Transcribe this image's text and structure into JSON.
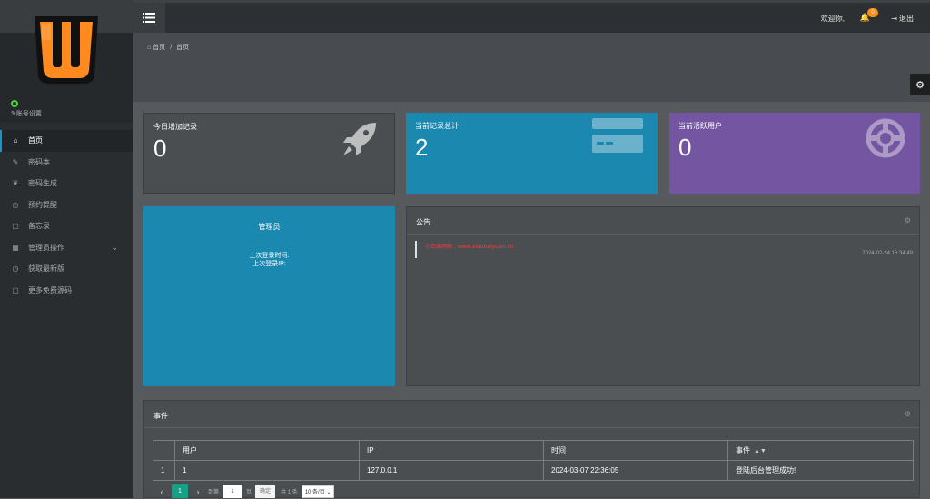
{
  "sidebar": {
    "account_settings": "账号设置",
    "items": [
      {
        "label": "首页",
        "icon": "home-icon",
        "active": true
      },
      {
        "label": "密码本",
        "icon": "edit-icon"
      },
      {
        "label": "密码生成",
        "icon": "leaf-icon"
      },
      {
        "label": "预约提醒",
        "icon": "clock-icon"
      },
      {
        "label": "备忘录",
        "icon": "note-icon"
      },
      {
        "label": "管理员操作",
        "icon": "grid-icon",
        "expandable": true
      },
      {
        "label": "获取最新版",
        "icon": "clock-icon"
      },
      {
        "label": "更多免费源码",
        "icon": "note-icon"
      }
    ]
  },
  "topbar": {
    "welcome": "欢迎你,",
    "bell_count": "0",
    "logout": "退出"
  },
  "breadcrumb": {
    "home": "首页",
    "current": "首页"
  },
  "stats": {
    "today_label": "今日增加记录",
    "today_value": "0",
    "total_label": "当前记录总计",
    "total_value": "2",
    "active_label": "当前活跃用户",
    "active_value": "0"
  },
  "admin": {
    "title": "管理员",
    "last_login_time": "上次登录时间:",
    "last_login_ip": "上次登录IP:"
  },
  "notice": {
    "title": "公告",
    "item_text": "小白源码网 : www.xiaobaiyuan.cn",
    "item_date": "2024-02-24 16:34:49"
  },
  "events": {
    "title": "事件",
    "columns": [
      "",
      "用户",
      "IP",
      "时间",
      "事件"
    ],
    "rows": [
      [
        "1",
        "1",
        "127.0.0.1",
        "2024-03-07 22:36:05",
        "登陆后台管理成功!"
      ]
    ]
  },
  "pager": {
    "current": "1",
    "goto_label": "到第",
    "goto_value": "1",
    "page_unit": "页",
    "confirm": "确定",
    "total": "共 1 条",
    "page_size": "10 条/页"
  },
  "colors": {
    "accent_blue": "#1b88b0",
    "accent_purple": "#7355a1",
    "badge_orange": "#ff8c1a",
    "pager_green": "#16a085",
    "status_green": "#4cd137"
  }
}
